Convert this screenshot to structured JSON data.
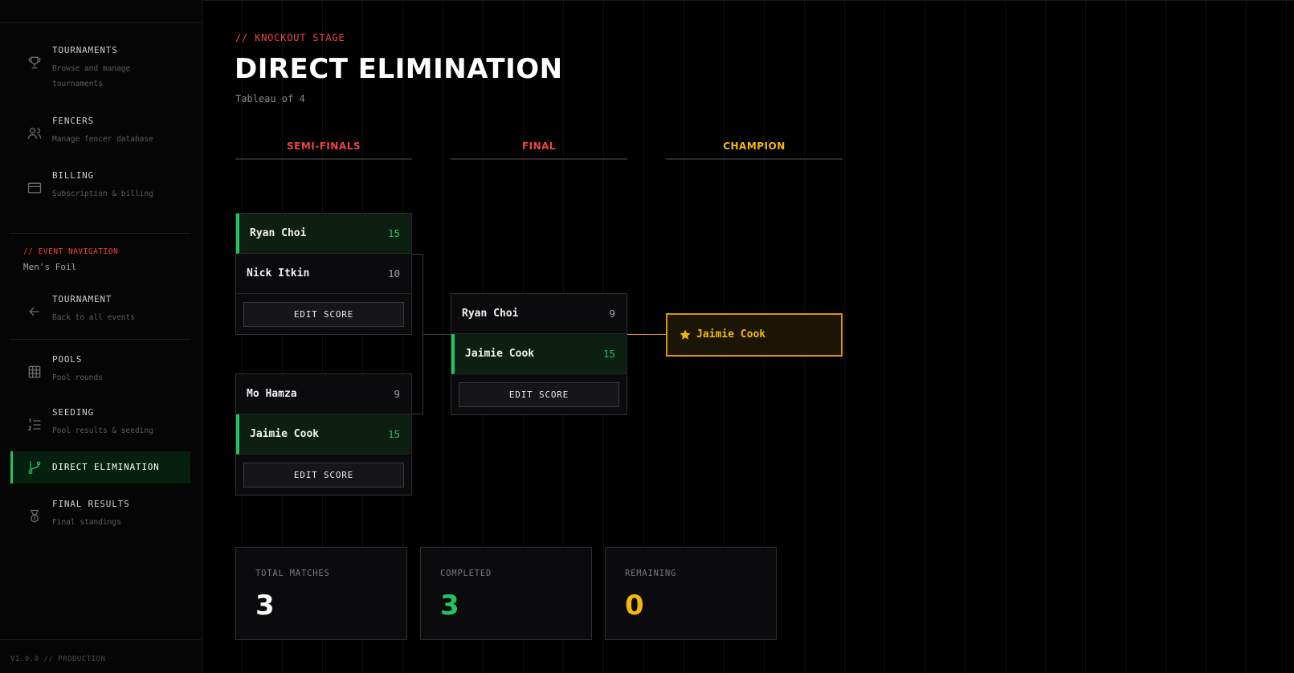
{
  "sidebar": {
    "items": [
      {
        "label": "TOURNAMENTS",
        "sub": "Browse and manage tournaments",
        "icon": "trophy-icon"
      },
      {
        "label": "FENCERS",
        "sub": "Manage fencer database",
        "icon": "users-icon"
      },
      {
        "label": "BILLING",
        "sub": "Subscription & billing",
        "icon": "credit-card-icon"
      }
    ],
    "event_nav_tag": "// EVENT NAVIGATION",
    "event_name": "Men's Foil",
    "event_items": [
      {
        "label": "TOURNAMENT",
        "sub": "Back to all events",
        "icon": "arrow-left-icon"
      },
      {
        "label": "POOLS",
        "sub": "Pool rounds",
        "icon": "grid-icon"
      },
      {
        "label": "SEEDING",
        "sub": "Pool results & seeding",
        "icon": "list-ordered-icon"
      },
      {
        "label": "DIRECT ELIMINATION",
        "sub": "",
        "icon": "git-branch-icon",
        "active": true
      },
      {
        "label": "FINAL RESULTS",
        "sub": "Final standings",
        "icon": "medal-icon"
      }
    ],
    "version": "V1.0.0 // PRODUCTION"
  },
  "page": {
    "kicker": "// KNOCKOUT STAGE",
    "title": "DIRECT ELIMINATION",
    "subtitle": "Tableau of 4"
  },
  "rounds": {
    "semis": "SEMI-FINALS",
    "final": "FINAL",
    "champion": "CHAMPION"
  },
  "matches": [
    {
      "round": "semi",
      "a": {
        "name": "Ryan Choi",
        "score": "15",
        "winner": true
      },
      "b": {
        "name": "Nick Itkin",
        "score": "10",
        "winner": false
      },
      "button": "EDIT SCORE"
    },
    {
      "round": "semi",
      "a": {
        "name": "Mo Hamza",
        "score": "9",
        "winner": false
      },
      "b": {
        "name": "Jaimie Cook",
        "score": "15",
        "winner": true
      },
      "button": "EDIT SCORE"
    },
    {
      "round": "final",
      "a": {
        "name": "Ryan Choi",
        "score": "9",
        "winner": false
      },
      "b": {
        "name": "Jaimie Cook",
        "score": "15",
        "winner": true
      },
      "button": "EDIT SCORE"
    }
  ],
  "champion": {
    "name": "Jaimie Cook",
    "icon": "star-icon"
  },
  "stats": [
    {
      "label": "TOTAL MATCHES",
      "value": "3",
      "color": "#ffffff"
    },
    {
      "label": "COMPLETED",
      "value": "3",
      "color": "#22c55e"
    },
    {
      "label": "REMAINING",
      "value": "0",
      "color": "#f5b70b"
    }
  ],
  "colors": {
    "accent_green": "#22c55e",
    "accent_red": "#ef4444",
    "accent_gold": "#f5b70b"
  }
}
